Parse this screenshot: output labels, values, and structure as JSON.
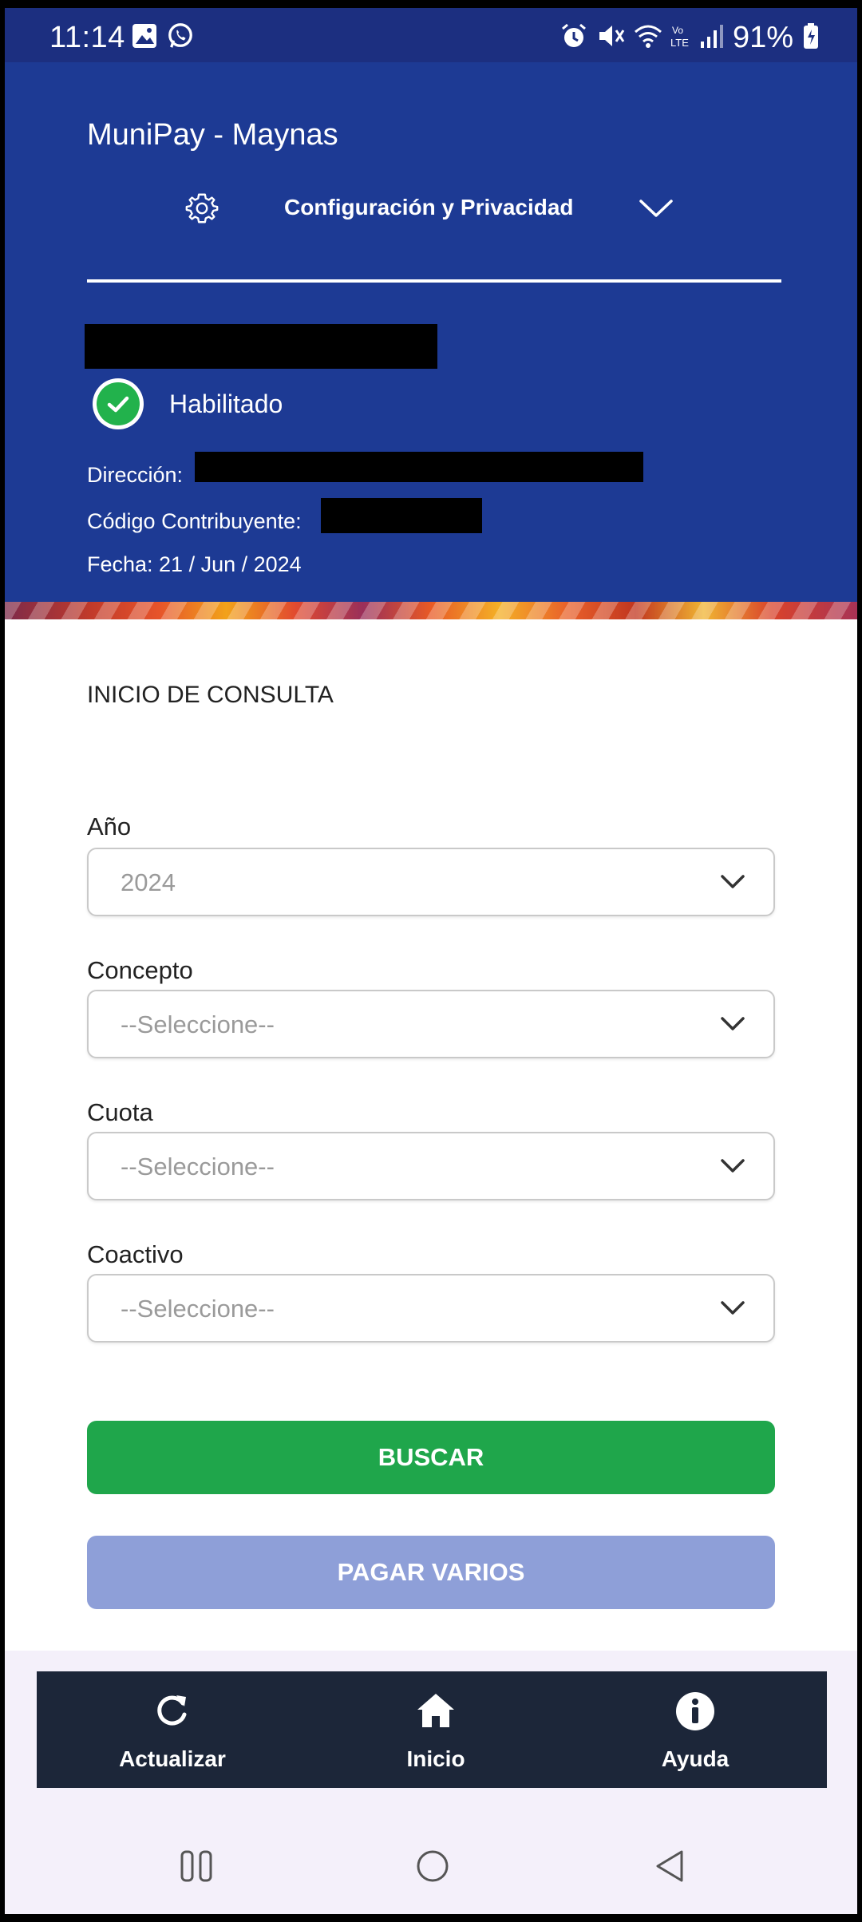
{
  "status_bar": {
    "time": "11:14",
    "battery": "91%",
    "left_icons": [
      "gallery-icon",
      "whatsapp-icon"
    ],
    "right_icons": [
      "alarm-icon",
      "mute-icon",
      "wifi-icon",
      "volte-icon",
      "signal-icon",
      "battery-icon"
    ]
  },
  "header": {
    "app_title": "MuniPay - Maynas",
    "config_label": "Configuración y Privacidad",
    "status_label": "Habilitado",
    "direccion_label": "Dirección:",
    "codigo_label": "Código Contribuyente:",
    "fecha_label": "Fecha: 21 / Jun / 2024"
  },
  "form": {
    "section_title": "INICIO DE CONSULTA",
    "fields": [
      {
        "label": "Año",
        "value": "2024"
      },
      {
        "label": "Concepto",
        "value": "--Seleccione--"
      },
      {
        "label": "Cuota",
        "value": "--Seleccione--"
      },
      {
        "label": "Coactivo",
        "value": "--Seleccione--"
      }
    ],
    "buscar_label": "BUSCAR",
    "pagar_label": "PAGAR VARIOS"
  },
  "bottom_nav": {
    "items": [
      {
        "label": "Actualizar",
        "icon": "refresh-icon"
      },
      {
        "label": "Inicio",
        "icon": "home-icon"
      },
      {
        "label": "Ayuda",
        "icon": "info-icon"
      }
    ]
  },
  "colors": {
    "header_bg": "#1d3a94",
    "buscar_bg": "#1fa64b",
    "pagar_bg": "#8e9fd8",
    "nav_bg": "#1c2639",
    "status_ok": "#22b24c"
  }
}
